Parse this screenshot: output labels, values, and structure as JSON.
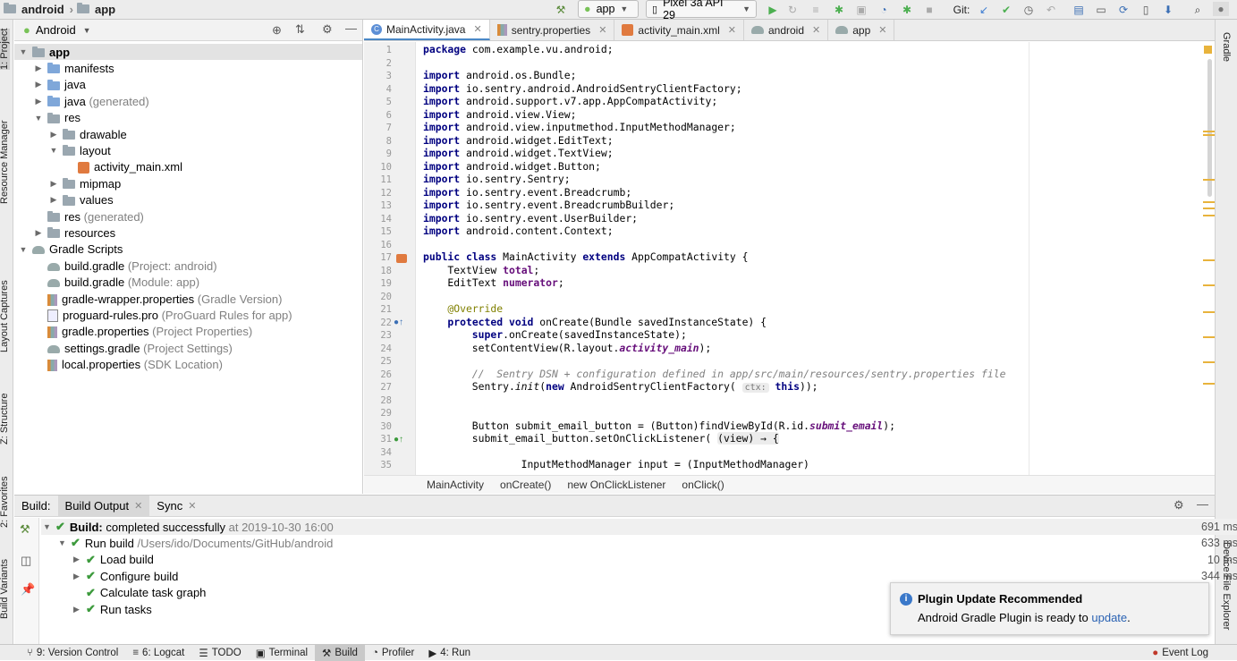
{
  "topbar": {
    "project": "android",
    "module": "app",
    "run_config": "app",
    "device": "Pixel 3a API 29",
    "git_label": "Git:"
  },
  "left_tools": [
    "1: Project",
    "Resource Manager",
    "Layout Captures",
    "Z: Structure",
    "2: Favorites",
    "Build Variants"
  ],
  "right_tools": [
    "Gradle",
    "Device File Explorer"
  ],
  "project": {
    "view_mode": "Android",
    "tree": [
      {
        "label": "app",
        "suffix": "",
        "depth": 0,
        "arrow": "down",
        "icon": "folder",
        "bold": true
      },
      {
        "label": "manifests",
        "suffix": "",
        "depth": 1,
        "arrow": "right",
        "icon": "folder-blue"
      },
      {
        "label": "java",
        "suffix": "",
        "depth": 1,
        "arrow": "right",
        "icon": "folder-blue"
      },
      {
        "label": "java",
        "suffix": " (generated)",
        "depth": 1,
        "arrow": "right",
        "icon": "folder-blue"
      },
      {
        "label": "res",
        "suffix": "",
        "depth": 1,
        "arrow": "down",
        "icon": "folder"
      },
      {
        "label": "drawable",
        "suffix": "",
        "depth": 2,
        "arrow": "right",
        "icon": "folder"
      },
      {
        "label": "layout",
        "suffix": "",
        "depth": 2,
        "arrow": "down",
        "icon": "folder"
      },
      {
        "label": "activity_main.xml",
        "suffix": "",
        "depth": 3,
        "arrow": "",
        "icon": "xml"
      },
      {
        "label": "mipmap",
        "suffix": "",
        "depth": 2,
        "arrow": "right",
        "icon": "folder"
      },
      {
        "label": "values",
        "suffix": "",
        "depth": 2,
        "arrow": "right",
        "icon": "folder"
      },
      {
        "label": "res",
        "suffix": " (generated)",
        "depth": 1,
        "arrow": "",
        "icon": "folder"
      },
      {
        "label": "resources",
        "suffix": "",
        "depth": 1,
        "arrow": "right",
        "icon": "folder"
      },
      {
        "label": "Gradle Scripts",
        "suffix": "",
        "depth": 0,
        "arrow": "down",
        "icon": "gradle"
      },
      {
        "label": "build.gradle",
        "suffix": " (Project: android)",
        "depth": 1,
        "arrow": "",
        "icon": "gradle"
      },
      {
        "label": "build.gradle",
        "suffix": " (Module: app)",
        "depth": 1,
        "arrow": "",
        "icon": "gradle"
      },
      {
        "label": "gradle-wrapper.properties",
        "suffix": " (Gradle Version)",
        "depth": 1,
        "arrow": "",
        "icon": "prop"
      },
      {
        "label": "proguard-rules.pro",
        "suffix": " (ProGuard Rules for app)",
        "depth": 1,
        "arrow": "",
        "icon": "file"
      },
      {
        "label": "gradle.properties",
        "suffix": " (Project Properties)",
        "depth": 1,
        "arrow": "",
        "icon": "prop"
      },
      {
        "label": "settings.gradle",
        "suffix": " (Project Settings)",
        "depth": 1,
        "arrow": "",
        "icon": "gradle"
      },
      {
        "label": "local.properties",
        "suffix": " (SDK Location)",
        "depth": 1,
        "arrow": "",
        "icon": "prop"
      }
    ]
  },
  "tabs": [
    {
      "label": "MainActivity.java",
      "active": true
    },
    {
      "label": "sentry.properties",
      "active": false
    },
    {
      "label": "activity_main.xml",
      "active": false
    },
    {
      "label": "android",
      "active": false
    },
    {
      "label": "app",
      "active": false
    }
  ],
  "code_lines": [
    "1",
    "2",
    "3",
    "4",
    "5",
    "6",
    "7",
    "8",
    "9",
    "10",
    "11",
    "12",
    "13",
    "14",
    "15",
    "16",
    "17",
    "18",
    "19",
    "20",
    "21",
    "22",
    "23",
    "24",
    "25",
    "26",
    "27",
    "28",
    "29",
    "30",
    "31",
    "34",
    "35"
  ],
  "code": {
    "l1": "package com.example.vu.android;",
    "l3": "android.os.Bundle;",
    "l4": "io.sentry.android.AndroidSentryClientFactory;",
    "l5": "android.support.v7.app.AppCompatActivity;",
    "l6": "android.view.View;",
    "l7": "android.view.inputmethod.InputMethodManager;",
    "l8": "android.widget.EditText;",
    "l9": "android.widget.TextView;",
    "l10": "android.widget.Button;",
    "l11": "io.sentry.Sentry;",
    "l12": "io.sentry.event.Breadcrumb;",
    "l13": "io.sentry.event.BreadcrumbBuilder;",
    "l14": "io.sentry.event.UserBuilder;",
    "l15": "android.content.Context;",
    "import_kw": "import",
    "l17_a": "public class",
    "l17_b": " MainActivity ",
    "l17_c": "extends",
    "l17_d": " AppCompatActivity {",
    "l18_a": "TextView ",
    "l18_b": "total",
    "l19_a": "EditText ",
    "l19_b": "numerator",
    "l21": "@Override",
    "l22_a": "protected void",
    "l22_b": " onCreate(Bundle savedInstanceState) {",
    "l23_a": "super",
    "l23_b": ".onCreate(savedInstanceState);",
    "l24_a": "setContentView(R.layout.",
    "l24_b": "activity_main",
    "l24_c": ");",
    "l26": "//  Sentry DSN + configuration defined in app/src/main/resources/sentry.properties file",
    "l27_a": "Sentry.",
    "l27_b": "init",
    "l27_c": "(",
    "l27_d": "new",
    "l27_e": " AndroidSentryClientFactory(",
    "l27_hint": "ctx:",
    "l27_f": "this",
    "l27_g": "));",
    "l30_a": "Button submit_email_button = (Button)findViewById(R.id.",
    "l30_b": "submit_email",
    "l30_c": ");",
    "l31_a": "submit_email_button.setOnClickListener(",
    "l31_b": "(view) → {",
    "l35": "InputMethodManager input = (InputMethodManager)"
  },
  "breadcrumb": [
    "MainActivity",
    "onCreate()",
    "new OnClickListener",
    "onClick()"
  ],
  "build": {
    "tabs": [
      "Build:",
      "Build Output",
      "Sync"
    ],
    "rows": [
      {
        "label_bold": "Build:",
        "label": " completed successfully",
        "time": " at 2019-10-30 16:00",
        "ms": "691 ms"
      },
      {
        "label_bold": "",
        "label": "Run build",
        "time": " /Users/ido/Documents/GitHub/android",
        "ms": "633 ms"
      },
      {
        "label_bold": "",
        "label": "Load build",
        "time": "",
        "ms": "10 ms"
      },
      {
        "label_bold": "",
        "label": "Configure build",
        "time": "",
        "ms": "344 ms"
      },
      {
        "label_bold": "",
        "label": "Calculate task graph",
        "time": "",
        "ms": ""
      },
      {
        "label_bold": "",
        "label": "Run tasks",
        "time": "",
        "ms": ""
      }
    ]
  },
  "notification": {
    "title": "Plugin Update Recommended",
    "body": "Android Gradle Plugin is ready to ",
    "link": "update",
    "end": "."
  },
  "statusbar": {
    "items": [
      "9: Version Control",
      "6: Logcat",
      "TODO",
      "Terminal",
      "Build",
      "Profiler",
      "4: Run"
    ],
    "right": "Event Log"
  },
  "colors": {
    "accent": "#4a88c7",
    "success": "#3c9a3c",
    "keyword": "#000080",
    "warning_mark": "#e8b33c"
  }
}
